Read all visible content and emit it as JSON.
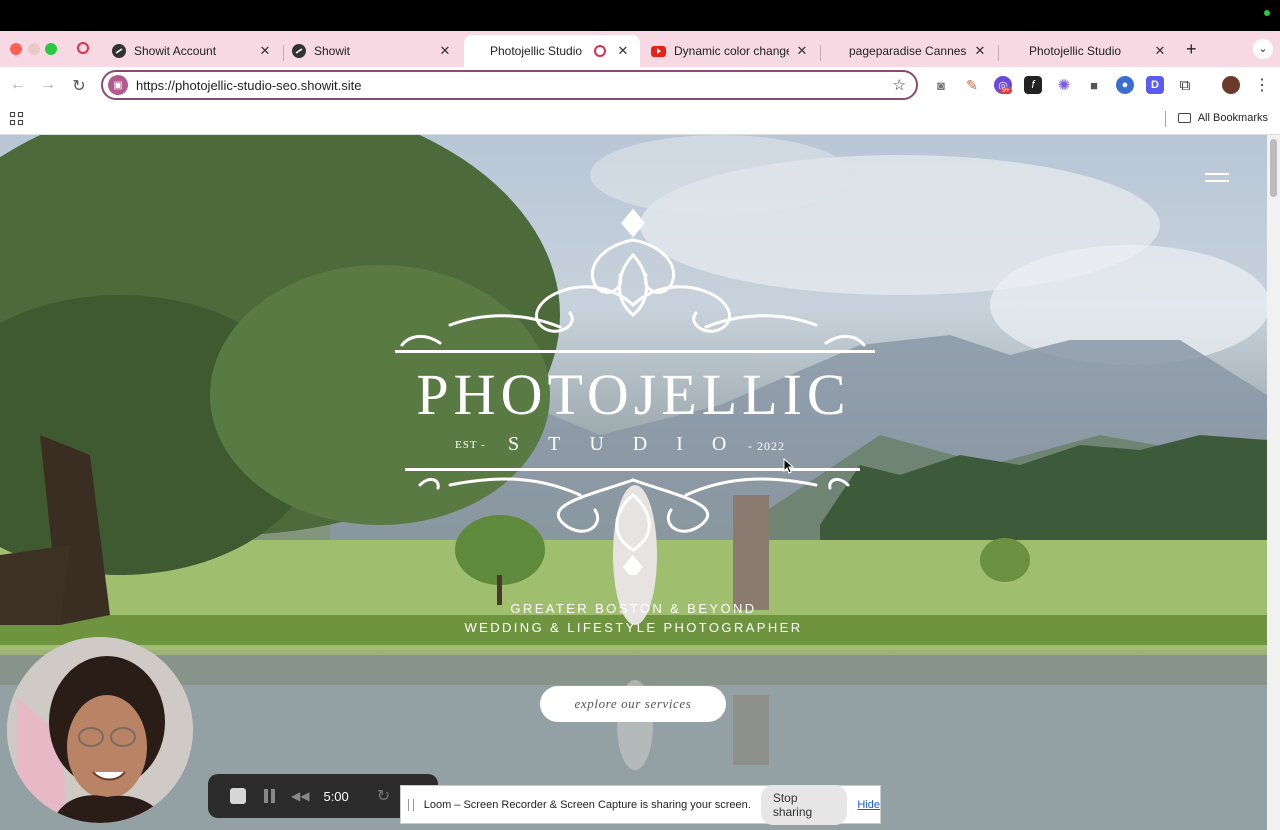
{
  "browser": {
    "tabs": [
      {
        "title": "Showit Account",
        "favicon": "showit-icon",
        "active": false
      },
      {
        "title": "Showit",
        "favicon": "showit-icon",
        "active": false
      },
      {
        "title": "Photojellic Studio",
        "favicon": "",
        "active": true,
        "recording": true
      },
      {
        "title": "Dynamic color change w",
        "favicon": "youtube-icon",
        "active": false
      },
      {
        "title": "pageparadise Cannes Sh",
        "favicon": "",
        "active": false
      },
      {
        "title": "Photojellic Studio",
        "favicon": "",
        "active": false
      }
    ],
    "url": "https://photojellic-studio-seo.showit.site",
    "extensions_badge": "9+",
    "bookmarks_label": "All Bookmarks",
    "accent_color": "#8a4a76",
    "tabstrip_color": "#f7d9e3"
  },
  "hero": {
    "title": "PHOTOJELLIC",
    "est_label": "EST -",
    "studio_label": "STUDIO",
    "year_label": "- 2022",
    "tagline_line1": "GREATER BOSTON & BEYOND",
    "tagline_line2": "WEDDING & LIFESTYLE PHOTOGRAPHER",
    "cta_label": "explore our services"
  },
  "loom": {
    "timer": "5:00",
    "share_message": "Loom – Screen Recorder & Screen Capture is sharing your screen.",
    "stop_label": "Stop sharing",
    "hide_label": "Hide"
  }
}
